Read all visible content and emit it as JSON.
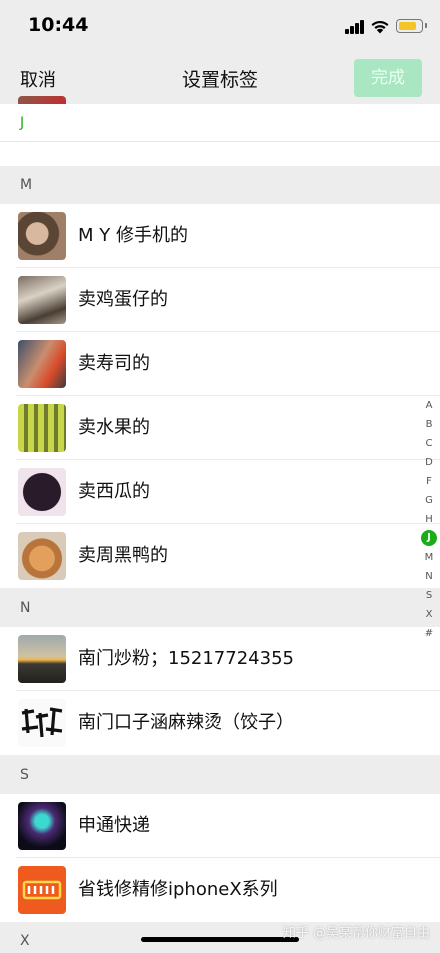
{
  "status": {
    "time": "10:44",
    "battery_color": "#f3c623"
  },
  "nav": {
    "cancel": "取消",
    "title": "设置标签",
    "done": "完成",
    "done_color": "#a9e6c2"
  },
  "sticky_header": "J",
  "sections": {
    "m": "M",
    "n": "N",
    "s": "S",
    "x": "X"
  },
  "contacts": {
    "m1": "M Y 修手机的",
    "m2": "卖鸡蛋仔的",
    "m3": "卖寿司的",
    "m4": "卖水果的",
    "m5": "卖西瓜的",
    "m6": "卖周黑鸭的",
    "n1": "南门炒粉；15217724355",
    "n2": "南门口子涵麻辣烫（饺子）",
    "s1": "申通快递",
    "s2": "省钱修精修iphoneX系列"
  },
  "index_letters": [
    "A",
    "B",
    "C",
    "D",
    "F",
    "G",
    "H",
    "J",
    "M",
    "N",
    "S",
    "X",
    "#"
  ],
  "index_active": "J",
  "watermark": "知乎 @吴某帮你财富自由",
  "accent": "#1aad19"
}
